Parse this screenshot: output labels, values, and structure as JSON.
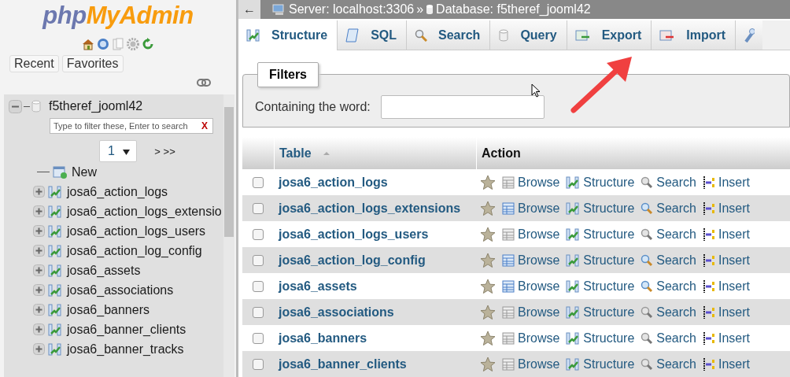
{
  "logo": {
    "prefix": "php",
    "suffix": "MyAdmin"
  },
  "nav_buttons": [
    "Recent",
    "Favorites"
  ],
  "tree": {
    "database": "f5theref_jooml42",
    "expanded": true,
    "filter_placeholder": "Type to filter these, Enter to search",
    "clear": "X",
    "page": "1",
    "page_nav": "> >>",
    "new_item": "New",
    "tables": [
      {
        "name": "josa6_action_logs",
        "expanded": false
      },
      {
        "name": "josa6_action_logs_extensio",
        "expanded": false
      },
      {
        "name": "josa6_action_logs_users",
        "expanded": false
      },
      {
        "name": "josa6_action_log_config",
        "expanded": false
      },
      {
        "name": "josa6_assets",
        "expanded": false
      },
      {
        "name": "josa6_associations",
        "expanded": false
      },
      {
        "name": "josa6_banners",
        "expanded": false
      },
      {
        "name": "josa6_banner_clients",
        "expanded": false
      },
      {
        "name": "josa6_banner_tracks",
        "expanded": false
      }
    ]
  },
  "breadcrumb": {
    "back": "←",
    "server": "Server: localhost:3306",
    "separator": "»",
    "database": "Database: f5theref_jooml42"
  },
  "tabs": [
    {
      "kind": "structure",
      "label": "Structure",
      "selected": true
    },
    {
      "kind": "sql",
      "label": "SQL",
      "selected": false
    },
    {
      "kind": "search",
      "label": "Search",
      "selected": false
    },
    {
      "kind": "query",
      "label": "Query",
      "selected": false
    },
    {
      "kind": "export",
      "label": "Export",
      "selected": false
    },
    {
      "kind": "import",
      "label": "Import",
      "selected": false
    }
  ],
  "filters": {
    "legend": "Filters",
    "label": "Containing the word:"
  },
  "table": {
    "columns": [
      "Table",
      "Action"
    ],
    "rows": [
      {
        "name": "josa6_action_logs",
        "checked": false,
        "has_rows": false,
        "actions": [
          "Browse",
          "Structure",
          "Search",
          "Insert"
        ]
      },
      {
        "name": "josa6_action_logs_extensions",
        "checked": false,
        "has_rows": true,
        "actions": [
          "Browse",
          "Structure",
          "Search",
          "Insert"
        ]
      },
      {
        "name": "josa6_action_logs_users",
        "checked": false,
        "has_rows": false,
        "actions": [
          "Browse",
          "Structure",
          "Search",
          "Insert"
        ]
      },
      {
        "name": "josa6_action_log_config",
        "checked": false,
        "has_rows": true,
        "actions": [
          "Browse",
          "Structure",
          "Search",
          "Insert"
        ]
      },
      {
        "name": "josa6_assets",
        "checked": false,
        "has_rows": true,
        "actions": [
          "Browse",
          "Structure",
          "Search",
          "Insert"
        ]
      },
      {
        "name": "josa6_associations",
        "checked": false,
        "has_rows": false,
        "actions": [
          "Browse",
          "Structure",
          "Search",
          "Insert"
        ]
      },
      {
        "name": "josa6_banners",
        "checked": false,
        "has_rows": false,
        "actions": [
          "Browse",
          "Structure",
          "Search",
          "Insert"
        ]
      },
      {
        "name": "josa6_banner_clients",
        "checked": false,
        "has_rows": false,
        "actions": [
          "Browse",
          "Structure",
          "Search",
          "Insert"
        ]
      }
    ]
  }
}
